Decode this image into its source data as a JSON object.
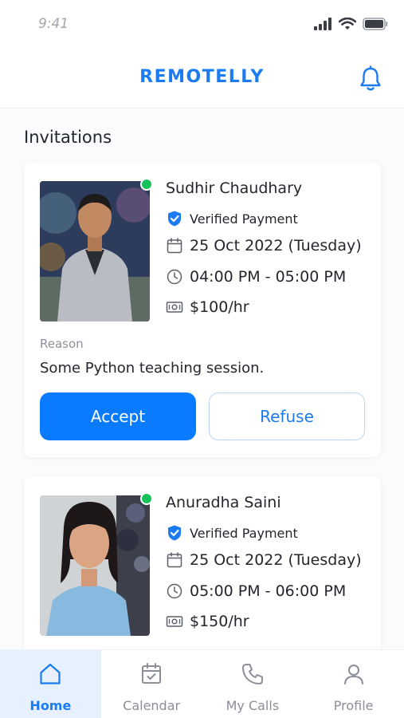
{
  "status_bar": {
    "time": "9:41"
  },
  "header": {
    "logo": "REMOTELLY"
  },
  "section": {
    "title": "Invitations"
  },
  "invitations": [
    {
      "name": "Sudhir Chaudhary",
      "verified_label": "Verified Payment",
      "date": "25 Oct 2022 (Tuesday)",
      "time": "04:00 PM - 05:00 PM",
      "rate": "$100/hr",
      "reason_label": "Reason",
      "reason": "Some Python teaching session.",
      "accept_label": "Accept",
      "refuse_label": "Refuse",
      "online": true
    },
    {
      "name": "Anuradha Saini",
      "verified_label": "Verified Payment",
      "date": "25 Oct 2022 (Tuesday)",
      "time": "05:00 PM - 06:00 PM",
      "rate": "$150/hr",
      "online": true
    }
  ],
  "tabs": [
    {
      "label": "Home",
      "icon": "home-icon",
      "active": true
    },
    {
      "label": "Calendar",
      "icon": "calendar-icon",
      "active": false
    },
    {
      "label": "My Calls",
      "icon": "phone-icon",
      "active": false
    },
    {
      "label": "Profile",
      "icon": "user-icon",
      "active": false
    }
  ],
  "colors": {
    "accent": "#0a7bff",
    "online": "#19c15b",
    "text": "#23262d",
    "muted": "#8d929b"
  }
}
